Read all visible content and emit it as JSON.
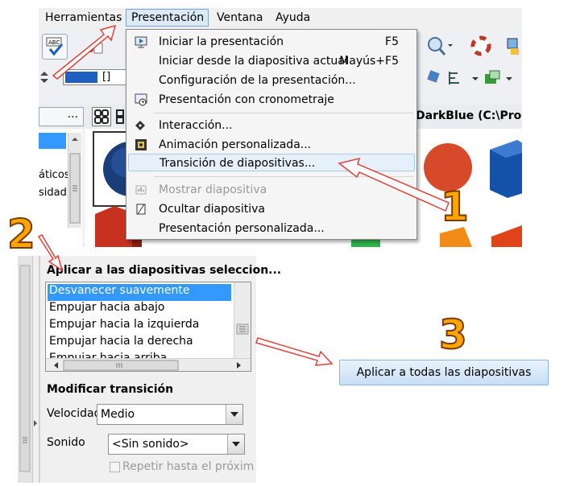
{
  "menubar": {
    "items": [
      "Herramientas",
      "Presentación",
      "Ventana",
      "Ayuda"
    ]
  },
  "toolbar": {
    "color_value": "[]"
  },
  "doc_title": "DarkBlue (C:\\Progr",
  "side_text": [
    "áticos",
    "sidad"
  ],
  "menu": {
    "items": [
      {
        "label": "Iniciar la presentación",
        "shortcut": "F5",
        "icon": "start-presentation-icon"
      },
      {
        "label": "Iniciar desde la diapositiva actual",
        "shortcut": "Mayús+F5",
        "icon": ""
      },
      {
        "label": "Configuración de la presentación...",
        "shortcut": "",
        "icon": ""
      },
      {
        "label": "Presentación con cronometraje",
        "shortcut": "",
        "icon": "rehearse-timings-icon"
      },
      {
        "label": "Interacción...",
        "shortcut": "",
        "icon": "interaction-icon"
      },
      {
        "label": "Animación personalizada...",
        "shortcut": "",
        "icon": "custom-animation-icon"
      },
      {
        "label": "Transición de diapositivas...",
        "shortcut": "",
        "icon": ""
      },
      {
        "label": "Mostrar diapositiva",
        "shortcut": "",
        "icon": "show-slide-icon"
      },
      {
        "label": "Ocultar diapositiva",
        "shortcut": "",
        "icon": "hide-slide-icon"
      },
      {
        "label": "Presentación personalizada...",
        "shortcut": "",
        "icon": ""
      }
    ]
  },
  "panel": {
    "apply_header": "Aplicar a las diapositivas seleccion...",
    "transitions": [
      "Desvanecer suavemente",
      "Empujar hacia abajo",
      "Empujar hacia la izquierda",
      "Empujar hacia la derecha",
      "Empujar hacia arriba"
    ],
    "modify_header": "Modificar transición",
    "speed_label": "Velocidad",
    "speed_value": "Medio",
    "sound_label": "Sonido",
    "sound_value": "<Sin sonido>",
    "repeat_label": "Repetir hasta el próxim"
  },
  "apply_all_button": "Aplicar a todas las diapositivas",
  "steps": [
    "1",
    "2",
    "3"
  ],
  "colors": {
    "accent_blue": "#1f5fbf",
    "selection": "#3399ff",
    "step_orange": "#ffa500",
    "arrow_red": "#e0413a"
  }
}
